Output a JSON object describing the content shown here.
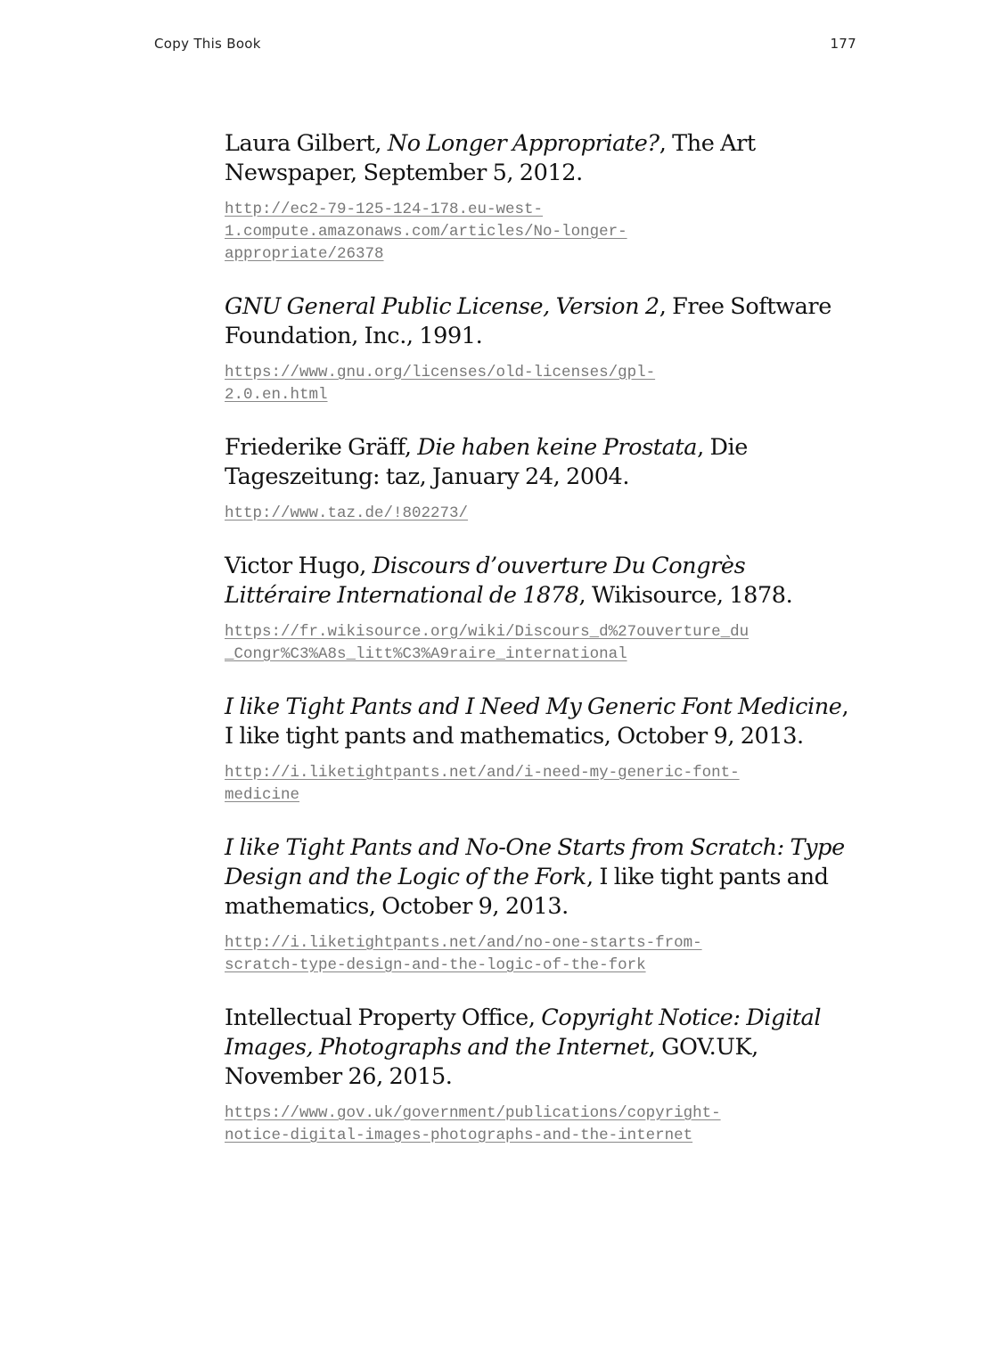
{
  "header": {
    "book_title": "Copy This Book",
    "page_number": "177"
  },
  "references": [
    {
      "before": "Laura Gilbert, ",
      "title": "No Longer Appropriate?",
      "after": ", The Art Newspaper, September 5, 2012.",
      "url_lines": [
        "http://ec2-79-125-124-178.eu-west-",
        "1.compute.amazonaws.com/articles/No-longer-",
        "appropriate/26378"
      ]
    },
    {
      "before": "",
      "title": "GNU General Public License, Version 2",
      "after": ", Free Software Foundation, Inc., 1991.",
      "url_lines": [
        "https://www.gnu.org/licenses/old-licenses/gpl-",
        "2.0.en.html"
      ]
    },
    {
      "before": "Friederike Gräff, ",
      "title": "Die haben keine Prostata",
      "after": ", Die Tageszeitung: taz, January 24, 2004.",
      "url_lines": [
        "http://www.taz.de/!802273/"
      ]
    },
    {
      "before": "Victor Hugo, ",
      "title": "Discours d’ouverture Du Congrès Littéraire International de 1878",
      "after": ", Wikisource, 1878.",
      "url_lines": [
        "https://fr.wikisource.org/wiki/Discours_d%27ouverture_du",
        "_Congr%C3%A8s_litt%C3%A9raire_international"
      ]
    },
    {
      "before": "",
      "title": "I like Tight Pants and I Need My Generic Font Medicine",
      "after": ", I like tight pants and mathematics, October 9, 2013.",
      "url_lines": [
        "http://i.liketightpants.net/and/i-need-my-generic-font-",
        "medicine"
      ]
    },
    {
      "before": "",
      "title": "I like Tight Pants and No-One Starts from Scratch: Type Design and the Logic of the Fork",
      "after": ", I like tight pants and mathematics, October 9, 2013.",
      "url_lines": [
        "http://i.liketightpants.net/and/no-one-starts-from-",
        "scratch-type-design-and-the-logic-of-the-fork"
      ]
    },
    {
      "before": "Intellectual Property Office, ",
      "title": "Copyright Notice: Digital Images, Photographs and the Internet",
      "after": ", GOV.UK, November 26, 2015.",
      "url_lines": [
        "https://www.gov.uk/government/publications/copyright-",
        "notice-digital-images-photographs-and-the-internet"
      ]
    }
  ]
}
